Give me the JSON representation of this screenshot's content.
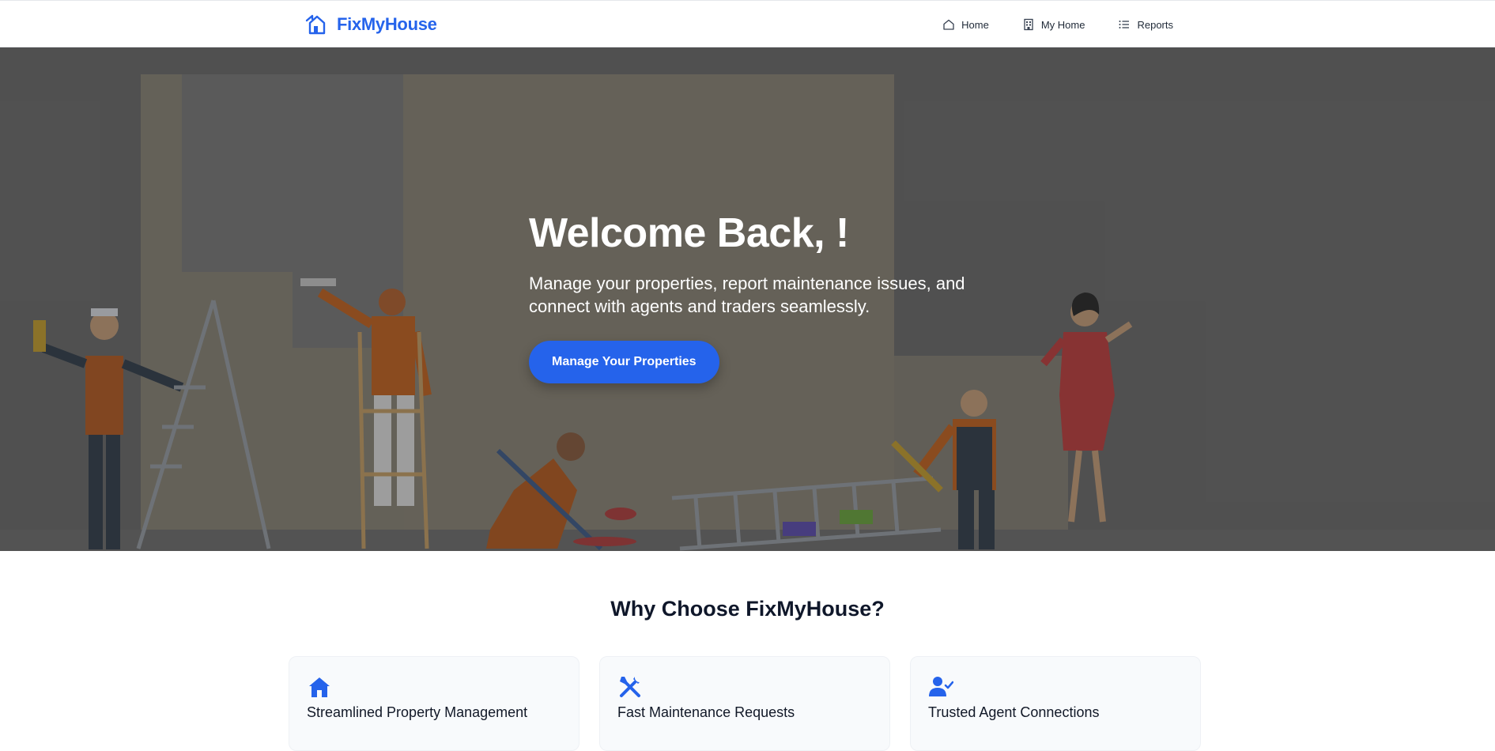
{
  "brand": {
    "name": "FixMyHouse",
    "icon": "house-arrow-icon",
    "color": "#2563eb"
  },
  "nav": {
    "items": [
      {
        "label": "Home",
        "icon": "home-icon"
      },
      {
        "label": "My Home",
        "icon": "building-icon"
      },
      {
        "label": "Reports",
        "icon": "list-icon"
      }
    ]
  },
  "hero": {
    "title": "Welcome Back, !",
    "subtitle": "Manage your properties, report maintenance issues, and connect with agents and traders seamlessly.",
    "cta_label": "Manage Your Properties"
  },
  "why": {
    "title": "Why Choose FixMyHouse?",
    "features": [
      {
        "title": "Streamlined Property Management",
        "icon": "house-icon"
      },
      {
        "title": "Fast Maintenance Requests",
        "icon": "tools-icon"
      },
      {
        "title": "Trusted Agent Connections",
        "icon": "user-check-icon"
      }
    ]
  },
  "colors": {
    "accent": "#2563eb",
    "heading": "#0f172a",
    "card_bg": "#f8fafc"
  }
}
